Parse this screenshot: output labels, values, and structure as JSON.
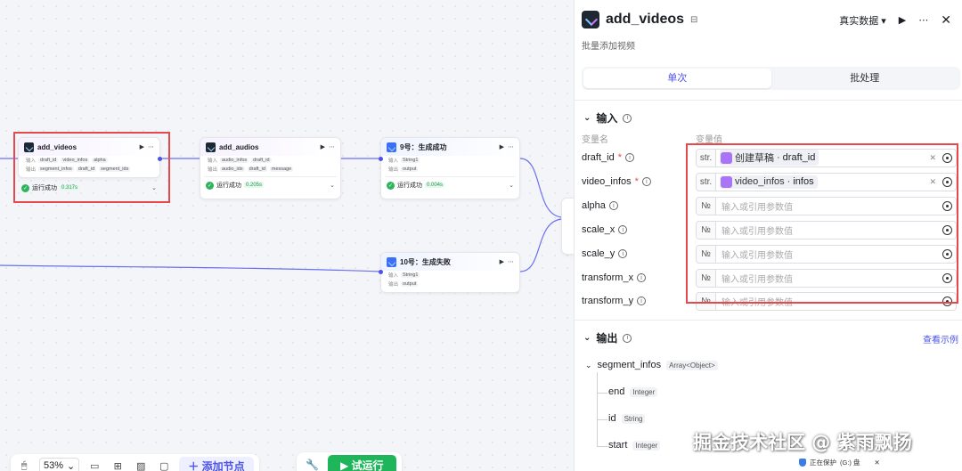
{
  "canvas": {
    "nodes": [
      {
        "id": "add_videos",
        "title": "add_videos",
        "inputs": [
          "draft_id",
          "video_infos",
          "alpha"
        ],
        "outputs": [
          "segment_infos",
          "draft_id",
          "segment_ids"
        ],
        "status": "运行成功",
        "time": "0.317s"
      },
      {
        "id": "add_audios",
        "title": "add_audios",
        "inputs": [
          "audio_infos",
          "draft_id"
        ],
        "outputs": [
          "audio_ids",
          "draft_id",
          "message"
        ],
        "status": "运行成功",
        "time": "0.205s"
      },
      {
        "id": "n9",
        "title": "9号：生成成功",
        "inputs": [
          "String1"
        ],
        "outputs": [
          "output"
        ],
        "status": "运行成功",
        "time": "0.004s"
      },
      {
        "id": "n10",
        "title": "10号：生成失败",
        "inputs": [
          "String1"
        ],
        "outputs": [
          "output"
        ]
      }
    ],
    "io_labels": {
      "input": "输入",
      "output": "输出"
    }
  },
  "toolbar": {
    "zoom": "53%",
    "add_node": "添加节点",
    "run": "试运行"
  },
  "panel": {
    "title": "add_videos",
    "subtitle": "批量添加视频",
    "data_mode": "真实数据",
    "tabs": [
      {
        "label": "单次"
      },
      {
        "label": "批处理"
      }
    ],
    "input_section": "输入",
    "col_name": "变量名",
    "col_value": "变量值",
    "params": [
      {
        "name": "draft_id",
        "required": "*",
        "type": "str.",
        "ref_node": "创建草稿",
        "ref_field": "draft_id"
      },
      {
        "name": "video_infos",
        "required": "*",
        "type": "str.",
        "ref_node": "video_infos",
        "ref_field": "infos"
      },
      {
        "name": "alpha",
        "required": "",
        "type": "№",
        "placeholder": "输入或引用参数值"
      },
      {
        "name": "scale_x",
        "required": "",
        "type": "№",
        "placeholder": "输入或引用参数值"
      },
      {
        "name": "scale_y",
        "required": "",
        "type": "№",
        "placeholder": "输入或引用参数值"
      },
      {
        "name": "transform_x",
        "required": "",
        "type": "№",
        "placeholder": "输入或引用参数值"
      },
      {
        "name": "transform_y",
        "required": "",
        "type": "№",
        "placeholder": "输入或引用参数值"
      }
    ],
    "output_section": "输出",
    "see_example": "查看示例",
    "output_tree": {
      "root": {
        "name": "segment_infos",
        "type": "Array<Object>"
      },
      "children": [
        {
          "name": "end",
          "type": "Integer"
        },
        {
          "name": "id",
          "type": "String"
        },
        {
          "name": "start",
          "type": "Integer"
        }
      ]
    }
  },
  "watermark": "掘金技术社区 @ 紫雨飘扬",
  "protect": {
    "label": "正在保护",
    "key": "(G:) 盘"
  }
}
